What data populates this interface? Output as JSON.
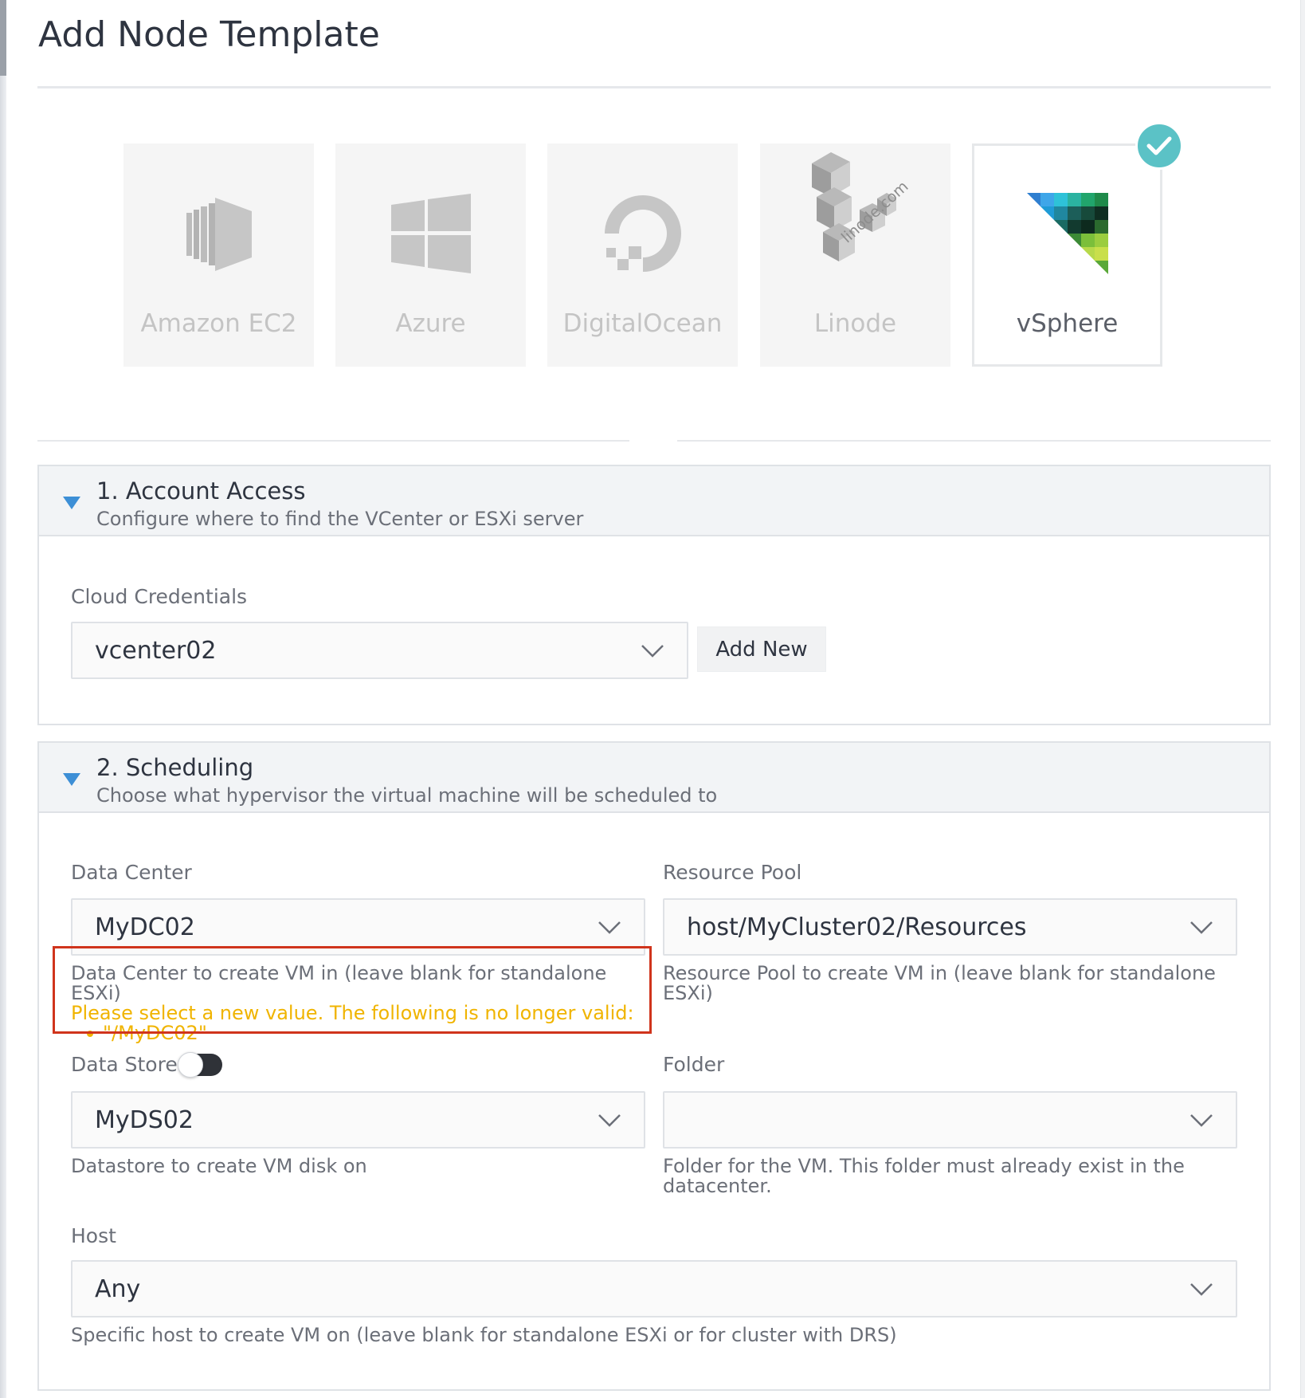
{
  "page": {
    "title": "Add Node Template"
  },
  "drivers": [
    {
      "name": "Amazon EC2",
      "icon": "amazon-ec2-icon",
      "selected": false
    },
    {
      "name": "Azure",
      "icon": "azure-windows-icon",
      "selected": false
    },
    {
      "name": "DigitalOcean",
      "icon": "digitalocean-icon",
      "selected": false
    },
    {
      "name": "Linode",
      "icon": "linode-cubes-icon",
      "logo_text": "linode.com",
      "selected": false
    },
    {
      "name": "vSphere",
      "icon": "vsphere-icon",
      "selected": true
    }
  ],
  "account_access": {
    "title": "1. Account Access",
    "subtitle": "Configure where to find the VCenter or ESXi server",
    "credentials_label": "Cloud Credentials",
    "credentials_value": "vcenter02",
    "add_new_label": "Add New"
  },
  "scheduling": {
    "title": "2. Scheduling",
    "subtitle": "Choose what hypervisor the virtual machine will be scheduled to",
    "data_center": {
      "label": "Data Center",
      "value": "MyDC02",
      "help": "Data Center to create VM in (leave blank for standalone ESXi)",
      "warning": "Please select a new value. The following is no longer valid:",
      "invalid_item": "\"/MyDC02\""
    },
    "resource_pool": {
      "label": "Resource Pool",
      "value": "host/MyCluster02/Resources",
      "help_line1": "Resource Pool to create VM in (leave blank for standalone",
      "help_line2": "ESXi)"
    },
    "data_store": {
      "label": "Data Store",
      "value": "MyDS02",
      "help": "Datastore to create VM disk on"
    },
    "folder": {
      "label": "Folder",
      "value": "",
      "help_line1": "Folder for the VM. This folder must already exist in the",
      "help_line2": "datacenter."
    },
    "host": {
      "label": "Host",
      "value": "Any",
      "help": "Specific host to create VM on (leave blank for standalone ESXi or for cluster with DRS)"
    }
  },
  "colors": {
    "accent": "#3d8fd6",
    "check": "#5bc2c6",
    "warning": "#f0b400",
    "highlight": "#d0341c"
  }
}
